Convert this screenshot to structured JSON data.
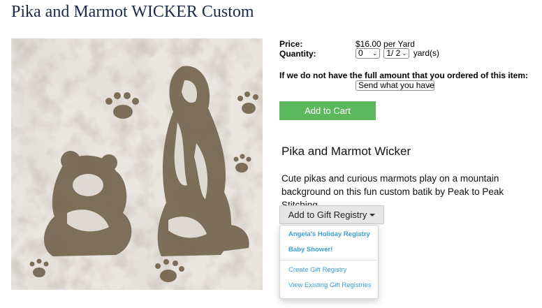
{
  "page": {
    "title": "Pika and Marmot WICKER Custom"
  },
  "purchase": {
    "price_label": "Price:",
    "price_value": "$16.00",
    "price_unit": "per Yard",
    "quantity_label": "Quantity:",
    "quantity_whole": "0",
    "quantity_fraction": "1/ 2",
    "quantity_unit": "yard(s)",
    "shortage_label": "If we do not have the full amount that you ordered of this item:",
    "shortage_option": "Send what you have",
    "add_to_cart": "Add to Cart"
  },
  "product": {
    "name": "Pika and Marmot Wicker",
    "description": "Cute pikas and curious marmots play on a mountain background on this fun custom batik by Peak to Peak Stitching."
  },
  "registry": {
    "button_label": "Add to Gift Registry",
    "menu": {
      "registries": [
        "Angela's Holiday Registry",
        "Baby Shower!"
      ],
      "create": "Create Gift Registry",
      "view": "View Existing Gift Registries"
    }
  },
  "colors": {
    "cart_button": "#5cb85c",
    "link": "#3aa0d8",
    "fabric_light": "#e9e5df",
    "fabric_dark": "#6b5a44"
  },
  "icons": {
    "select_arrow": "chevron-down-icon",
    "dropdown_caret": "caret-down-icon"
  }
}
